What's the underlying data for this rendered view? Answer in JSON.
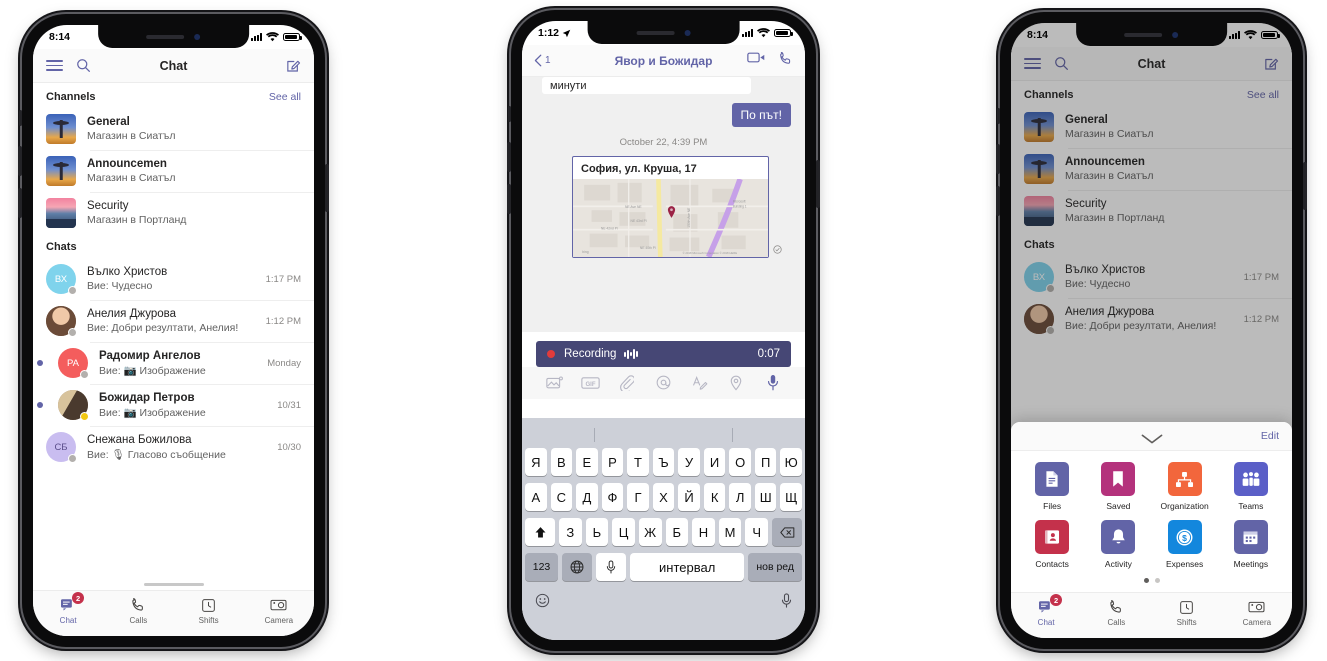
{
  "phone1": {
    "status": {
      "time": "8:14",
      "signal": "cellular-bars",
      "wifi": "wifi-icon",
      "battery": "battery-icon"
    },
    "header": {
      "menu": "hamburger-icon",
      "search": "search-icon",
      "title": "Chat",
      "compose": "compose-icon"
    },
    "channels_section": {
      "label": "Channels",
      "action": "See all"
    },
    "channels": [
      {
        "name": "General",
        "sub": "Магазин в Сиатъл",
        "thumb": "seattle"
      },
      {
        "name": "Announcemen",
        "sub": "Магазин в Сиатъл",
        "thumb": "seattle"
      },
      {
        "name": "Security",
        "sub": "Магазин в Портланд",
        "thumb": "portland"
      }
    ],
    "chats_section": {
      "label": "Chats"
    },
    "chats": [
      {
        "name": "Вълко Христов",
        "sub": "Вие: Чудесно",
        "time": "1:17 PM",
        "initials": "ВХ",
        "color": "#7fd3ec",
        "presence": "away",
        "unread": false,
        "bold": false,
        "photo": false
      },
      {
        "name": "Анелия Джурова",
        "sub": "Вие: Добри резултати, Анелия!",
        "time": "1:12 PM",
        "initials": "",
        "color": "#8a6a55",
        "presence": "away",
        "unread": false,
        "bold": false,
        "photo": true
      },
      {
        "name": "Радомир Ангелов",
        "sub": "Вие: 📷 Изображение",
        "time": "Monday",
        "initials": "РА",
        "color": "#f45d5d",
        "presence": "away",
        "unread": true,
        "bold": true,
        "photo": false
      },
      {
        "name": "Божидар Петров",
        "sub": "Вие: 📷 Изображение",
        "time": "10/31",
        "initials": "",
        "color": "#9a8167",
        "presence": "busy",
        "unread": true,
        "bold": true,
        "photo": true
      },
      {
        "name": "Снежана Божилова",
        "sub": "Вие: 🎙 Гласово съобщение",
        "time": "10/30",
        "initials": "СБ",
        "color": "#c9bdf0",
        "presence": "away",
        "unread": false,
        "bold": false,
        "photo": false
      }
    ],
    "tabs": [
      {
        "label": "Chat",
        "icon": "chat-icon",
        "badge": "2",
        "active": true
      },
      {
        "label": "Calls",
        "icon": "phone-icon",
        "badge": "",
        "active": false
      },
      {
        "label": "Shifts",
        "icon": "clock-icon",
        "badge": "",
        "active": false
      },
      {
        "label": "Camera",
        "icon": "camera-icon",
        "badge": "",
        "active": false
      }
    ]
  },
  "phone2": {
    "status": {
      "time": "1:12",
      "location": "location-arrow-icon",
      "signal": "cellular-bars",
      "wifi": "wifi-icon",
      "battery": "battery-icon"
    },
    "header": {
      "back": "back-chevron-icon",
      "back_count": "1",
      "title": "Явор и Божидар",
      "video": "video-call-icon",
      "call": "audio-call-icon"
    },
    "messages": {
      "incoming_partial": "минути",
      "outgoing": "По път!",
      "timestamp": "October 22, 4:39 PM"
    },
    "location_card": {
      "title": "София, ул. Круша, 17",
      "map_credit": "© 2018 Microsoft Corporation © 2018 HERE",
      "bing": "bing",
      "pin": "map-pin-icon",
      "read_receipt": "read-receipt-icon"
    },
    "recording": {
      "label": "Recording",
      "time": "0:07",
      "dot": "record-dot-icon",
      "wave": "audio-wave-icon"
    },
    "compose_icons": [
      "image-icon",
      "gif-icon",
      "attach-icon",
      "mention-icon",
      "format-icon",
      "location-icon",
      "mic-icon"
    ],
    "keyboard": {
      "row1": [
        "Я",
        "В",
        "Е",
        "Р",
        "Т",
        "Ъ",
        "У",
        "И",
        "О",
        "П",
        "Ю"
      ],
      "row2": [
        "А",
        "С",
        "Д",
        "Ф",
        "Г",
        "Х",
        "Й",
        "К",
        "Л",
        "Ш",
        "Щ"
      ],
      "row3": [
        "З",
        "Ь",
        "Ц",
        "Ж",
        "Б",
        "Н",
        "М",
        "Ч"
      ],
      "shift": "shift-icon",
      "backspace": "backspace-icon",
      "numbers": "123",
      "globe": "globe-icon",
      "dictate": "mic-icon",
      "space": "интервал",
      "return": "нов ред",
      "emoji": "emoji-icon",
      "bottom_mic": "mic-icon"
    }
  },
  "phone3": {
    "status": {
      "time": "8:14"
    },
    "header": {
      "title": "Chat"
    },
    "drawer": {
      "collapse": "chevron-down-icon",
      "edit": "Edit",
      "apps": [
        {
          "label": "Files",
          "color": "#6264a7",
          "icon": "file-icon"
        },
        {
          "label": "Saved",
          "color": "#b4327c",
          "icon": "bookmark-icon"
        },
        {
          "label": "Organization",
          "color": "#f2663c",
          "icon": "org-chart-icon"
        },
        {
          "label": "Teams",
          "color": "#5b5fc7",
          "icon": "teams-people-icon"
        },
        {
          "label": "Contacts",
          "color": "#c4314b",
          "icon": "contact-card-icon"
        },
        {
          "label": "Activity",
          "color": "#6264a7",
          "icon": "bell-icon"
        },
        {
          "label": "Expenses",
          "color": "#1387dd",
          "icon": "coin-icon"
        },
        {
          "label": "Meetings",
          "color": "#6264a7",
          "icon": "calendar-icon"
        }
      ],
      "page_dots": 2,
      "active_dot": 0
    }
  },
  "theme": {
    "accent": "#6264a7",
    "accent_dark": "#464775",
    "badge_red": "#c4314b",
    "text": "#252424",
    "muted": "#616161"
  }
}
